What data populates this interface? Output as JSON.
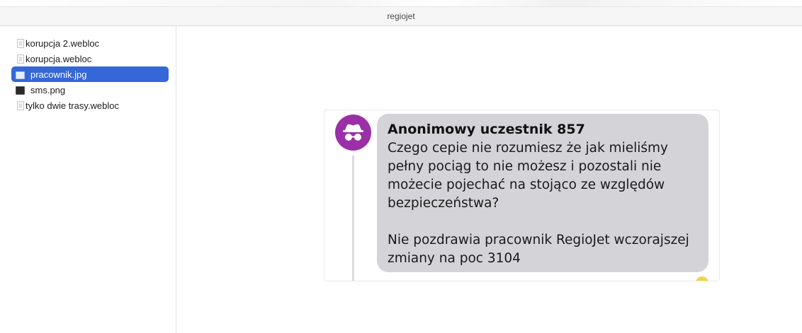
{
  "window": {
    "title": "regiojet"
  },
  "sidebar": {
    "files": [
      {
        "name": "korupcja 2.webloc",
        "icon": "webloc-file-icon",
        "selected": false
      },
      {
        "name": "korupcja.webloc",
        "icon": "webloc-file-icon",
        "selected": false
      },
      {
        "name": "pracownik.jpg",
        "icon": "image-file-icon",
        "selected": true
      },
      {
        "name": "sms.png",
        "icon": "image-thumbnail-icon",
        "selected": false
      },
      {
        "name": "tylko dwie trasy.webloc",
        "icon": "webloc-file-icon",
        "selected": false
      }
    ]
  },
  "post": {
    "avatar_icon": "incognito-icon",
    "avatar_color": "#9b2fa8",
    "author": "Anonimowy uczestnik 857",
    "message_lines_1": "Czego cepie nie rozumiesz że jak mieliśmy pełny pociąg to nie możesz i pozostali nie możecie pojechać na stojąco ze względów bezpieczeństwa?",
    "message_lines_2": "Nie pozdrawia pracownik RegioJet wczorajszej zmiany na poc 3104"
  },
  "colors": {
    "selection": "#3567d9",
    "bubble": "#d4d4d8"
  }
}
